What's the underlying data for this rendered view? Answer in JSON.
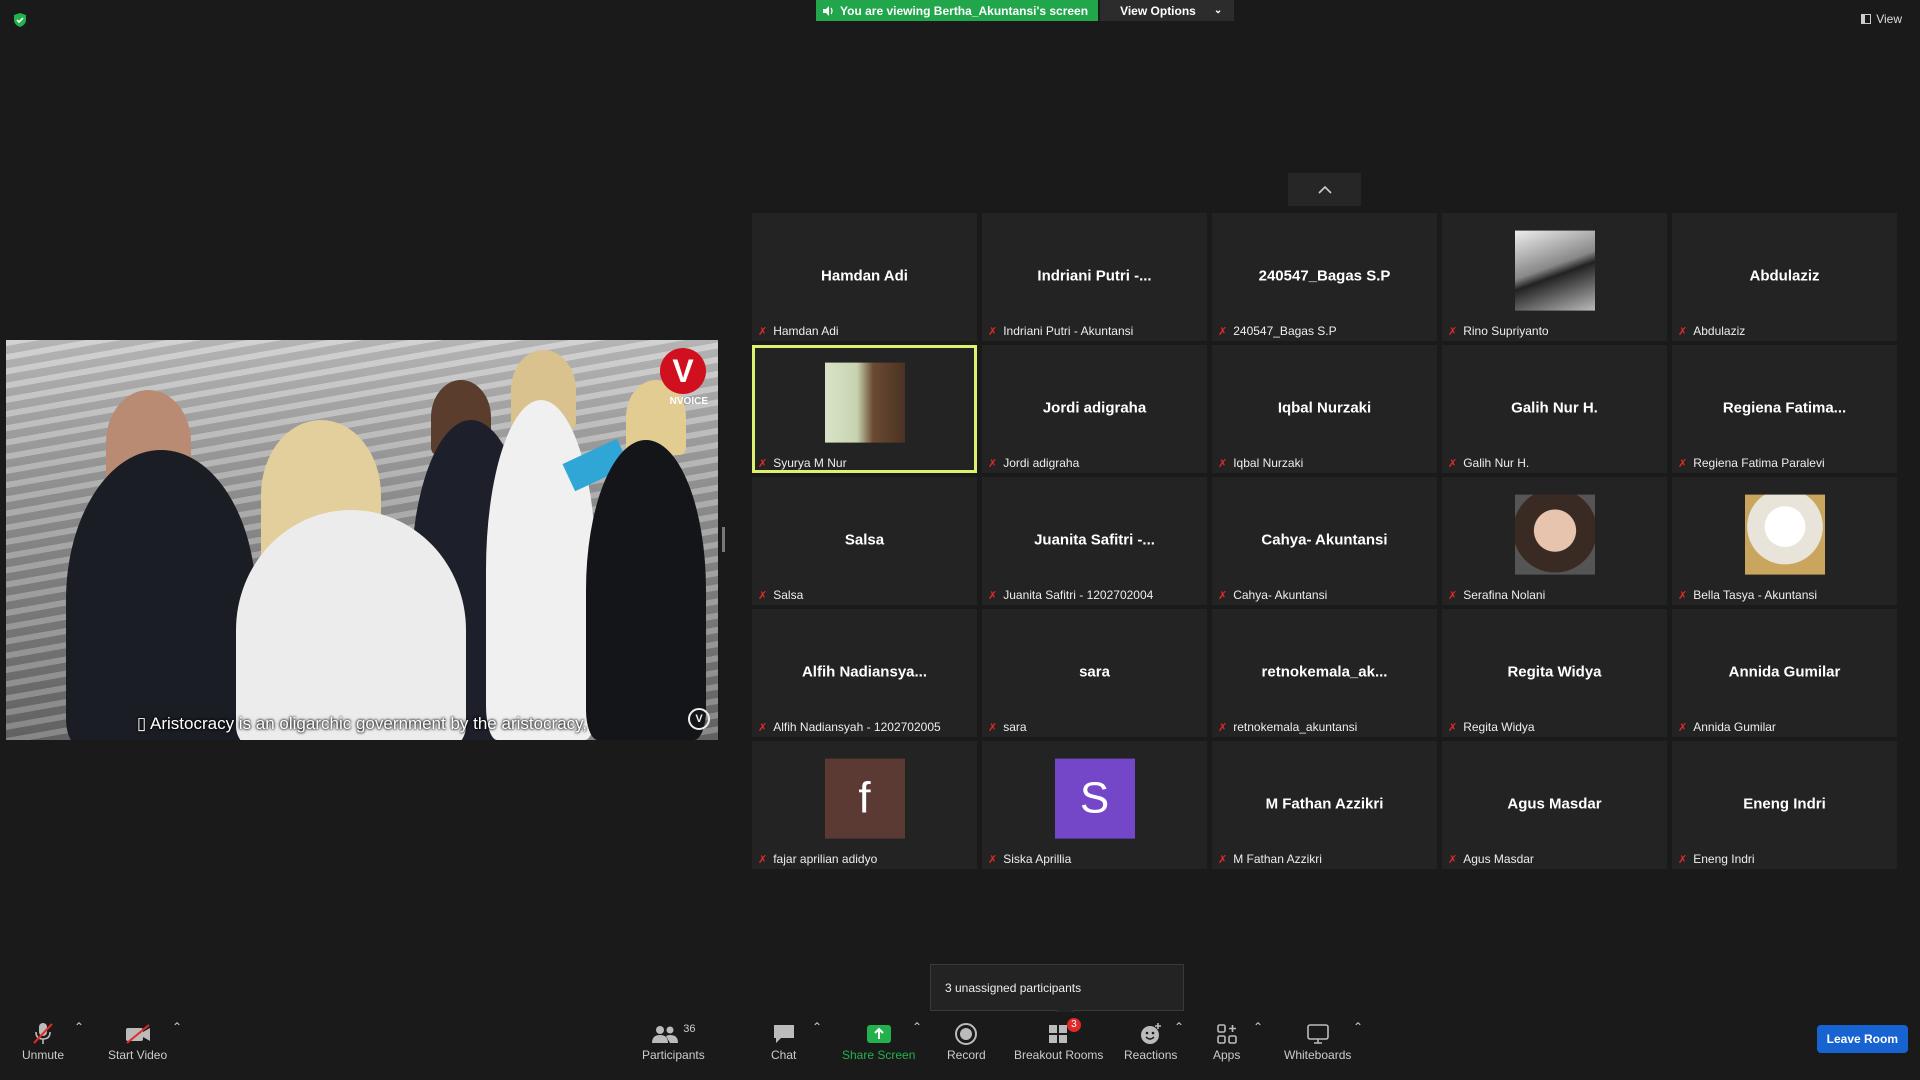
{
  "banner": {
    "viewing_text": "You are viewing Bertha_Akuntansi's screen",
    "view_options": "View Options"
  },
  "view_label": "View",
  "share": {
    "caption": "▯ Aristocracy is an oligarchic government by the aristocracy,",
    "logo_letter": "V",
    "logo_text": "NVOICE",
    "watermark": "V"
  },
  "tooltip": "3 unassigned participants",
  "participants": [
    {
      "display": "Hamdan Adi",
      "label": "Hamdan Adi"
    },
    {
      "display": "Indriani Putri -...",
      "label": "Indriani Putri - Akuntansi"
    },
    {
      "display": "240547_Bagas S.P",
      "label": "240547_Bagas S.P"
    },
    {
      "display": "",
      "label": "Rino Supriyanto",
      "avatar": "photo-bridge"
    },
    {
      "display": "Abdulaziz",
      "label": "Abdulaziz"
    },
    {
      "display": "",
      "label": "Syurya M Nur",
      "avatar": "photo-man-library",
      "active": true
    },
    {
      "display": "Jordi adigraha",
      "label": "Jordi adigraha"
    },
    {
      "display": "Iqbal Nurzaki",
      "label": "Iqbal Nurzaki"
    },
    {
      "display": "Galih Nur H.",
      "label": "Galih Nur H."
    },
    {
      "display": "Regiena Fatima...",
      "label": "Regiena Fatima Paralevi"
    },
    {
      "display": "Salsa",
      "label": "Salsa"
    },
    {
      "display": "Juanita Safitri -...",
      "label": "Juanita Safitri - 1202702004"
    },
    {
      "display": "Cahya- Akuntansi",
      "label": "Cahya- Akuntansi"
    },
    {
      "display": "",
      "label": "Serafina Nolani",
      "avatar": "photo-woman"
    },
    {
      "display": "",
      "label": "Bella Tasya - Akuntansi",
      "avatar": "photo-cartoon"
    },
    {
      "display": "Alfih Nadiansya...",
      "label": "Alfih Nadiansyah - 1202702005"
    },
    {
      "display": "sara",
      "label": "sara"
    },
    {
      "display": "retnokemala_ak...",
      "label": "retnokemala_akuntansi"
    },
    {
      "display": "Regita Widya",
      "label": "Regita Widya"
    },
    {
      "display": "Annida Gumilar",
      "label": "Annida Gumilar"
    },
    {
      "display": "",
      "label": "fajar aprilian adidyo",
      "avatar": "letter",
      "letter": "f",
      "color": "#5a3a33"
    },
    {
      "display": "",
      "label": "Siska Aprillia",
      "avatar": "letter",
      "letter": "S",
      "color": "#7446c8"
    },
    {
      "display": "M Fathan Azzikri",
      "label": "M Fathan Azzikri"
    },
    {
      "display": "Agus Masdar",
      "label": "Agus Masdar"
    },
    {
      "display": "Eneng Indri",
      "label": "Eneng Indri"
    }
  ],
  "toolbar": {
    "unmute": "Unmute",
    "start_video": "Start Video",
    "participants": "Participants",
    "participants_count": "36",
    "chat": "Chat",
    "share_screen": "Share Screen",
    "record": "Record",
    "breakout": "Breakout Rooms",
    "breakout_badge": "3",
    "reactions": "Reactions",
    "apps": "Apps",
    "whiteboards": "Whiteboards",
    "leave": "Leave Room"
  },
  "colors": {
    "share_green": "#21a64b",
    "leave_blue": "#1763d1",
    "active_border": "#dff070",
    "muted_red": "#e02a2a"
  }
}
